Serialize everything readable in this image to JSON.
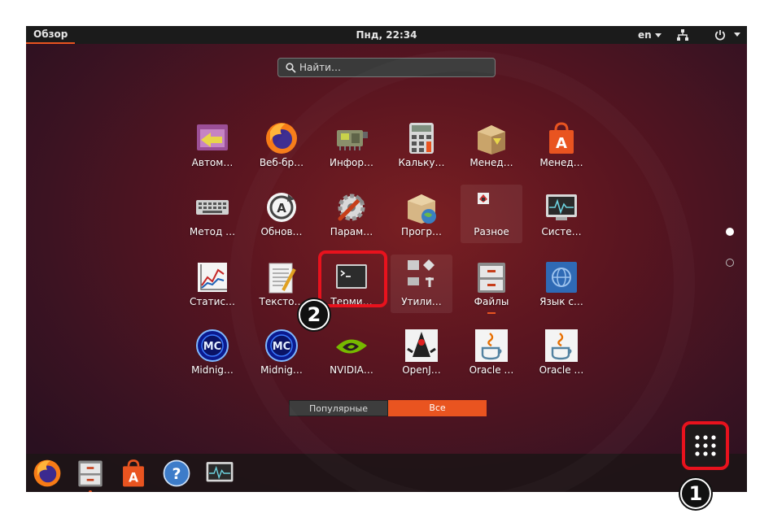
{
  "topbar": {
    "activities": "Обзор",
    "clock": "Пнд, 22:34",
    "language": "en"
  },
  "search": {
    "placeholder": "Найти…"
  },
  "apps": [
    {
      "label": "Автом…"
    },
    {
      "label": "Веб-бр…"
    },
    {
      "label": "Инфор…"
    },
    {
      "label": "Кальку…"
    },
    {
      "label": "Менед…"
    },
    {
      "label": "Менед…"
    },
    {
      "label": "Метод …"
    },
    {
      "label": "Обнов…"
    },
    {
      "label": "Парам…"
    },
    {
      "label": "Прогр…"
    },
    {
      "label": "Разное"
    },
    {
      "label": "Систе…"
    },
    {
      "label": "Статис…"
    },
    {
      "label": "Тексто…"
    },
    {
      "label": "Терми…"
    },
    {
      "label": "Утили…"
    },
    {
      "label": "Файлы"
    },
    {
      "label": "Язык с…"
    },
    {
      "label": "Midnig…"
    },
    {
      "label": "Midnig…"
    },
    {
      "label": "NVIDIA…"
    },
    {
      "label": "OpenJ…"
    },
    {
      "label": "Oracle …"
    },
    {
      "label": "Oracle …"
    }
  ],
  "tabs": {
    "popular": "Популярные",
    "all": "Все"
  },
  "annotations": {
    "step1": "1",
    "step2": "2"
  },
  "colors": {
    "accent": "#e95420",
    "highlight": "#e8121d"
  },
  "dock": {
    "items": [
      "firefox-icon",
      "files-icon",
      "software-icon",
      "help-icon",
      "system-monitor-icon"
    ]
  }
}
